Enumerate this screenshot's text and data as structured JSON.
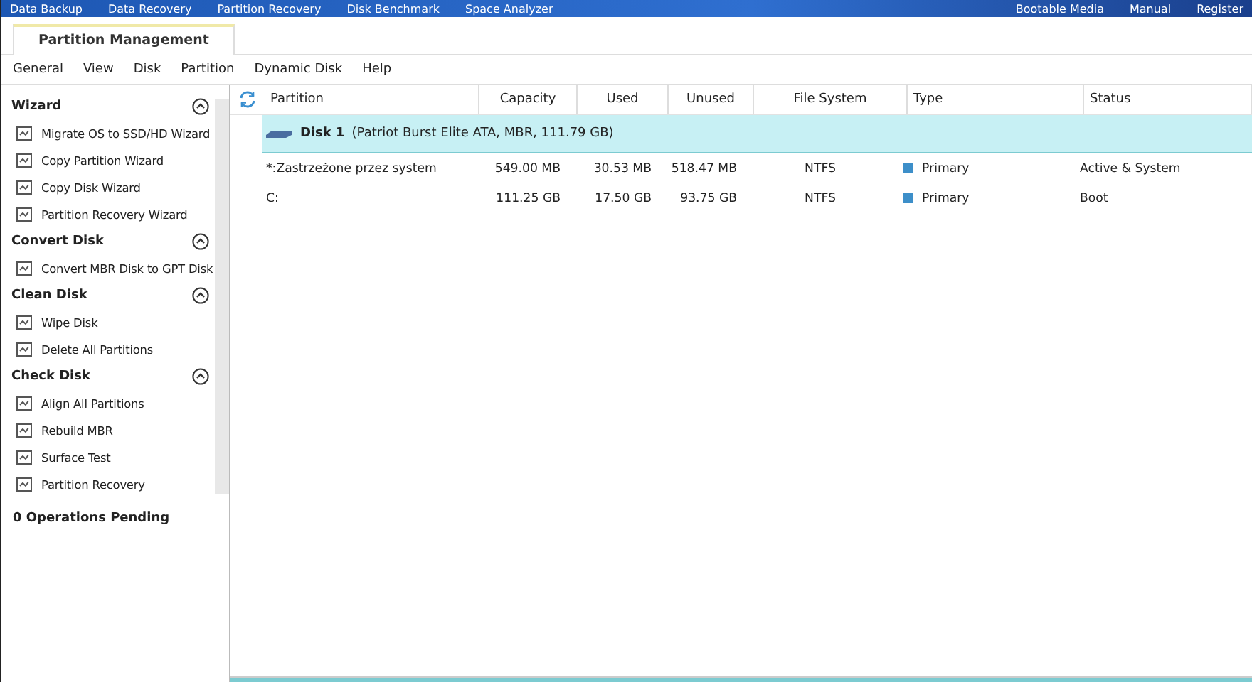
{
  "top_nav": {
    "left": [
      "Data Backup",
      "Data Recovery",
      "Partition Recovery",
      "Disk Benchmark",
      "Space Analyzer"
    ],
    "right": [
      "Bootable Media",
      "Manual",
      "Register"
    ]
  },
  "tabs": [
    {
      "label": "Partition Management",
      "selected": true
    }
  ],
  "menu": [
    "General",
    "View",
    "Disk",
    "Partition",
    "Dynamic Disk",
    "Help"
  ],
  "sidebar": {
    "sections": [
      {
        "title": "Wizard",
        "expanded": true,
        "items": [
          "Migrate OS to SSD/HD Wizard",
          "Copy Partition Wizard",
          "Copy Disk Wizard",
          "Partition Recovery Wizard"
        ]
      },
      {
        "title": "Convert Disk",
        "expanded": true,
        "items": [
          "Convert MBR Disk to GPT Disk"
        ]
      },
      {
        "title": "Clean Disk",
        "expanded": true,
        "items": [
          "Wipe Disk",
          "Delete All Partitions"
        ]
      },
      {
        "title": "Check Disk",
        "expanded": true,
        "items": [
          "Align All Partitions",
          "Rebuild MBR",
          "Surface Test",
          "Partition Recovery"
        ]
      }
    ],
    "pending": "0 Operations Pending"
  },
  "table": {
    "columns": [
      "Partition",
      "Capacity",
      "Used",
      "Unused",
      "File System",
      "Type",
      "Status"
    ],
    "disk": {
      "name": "Disk 1",
      "detail": "(Patriot Burst Elite ATA, MBR, 111.79 GB)",
      "selected": true
    },
    "rows": [
      {
        "cells": [
          "*:Zastrzeżone przez system",
          "549.00 MB",
          "30.53 MB",
          "518.47 MB",
          "NTFS",
          "Primary",
          "Active & System"
        ],
        "color": "#3d8fc9"
      },
      {
        "cells": [
          "C:",
          "111.25 GB",
          "17.50 GB",
          "93.75 GB",
          "NTFS",
          "Primary",
          "Boot"
        ],
        "color": "#3d8fc9"
      }
    ]
  }
}
